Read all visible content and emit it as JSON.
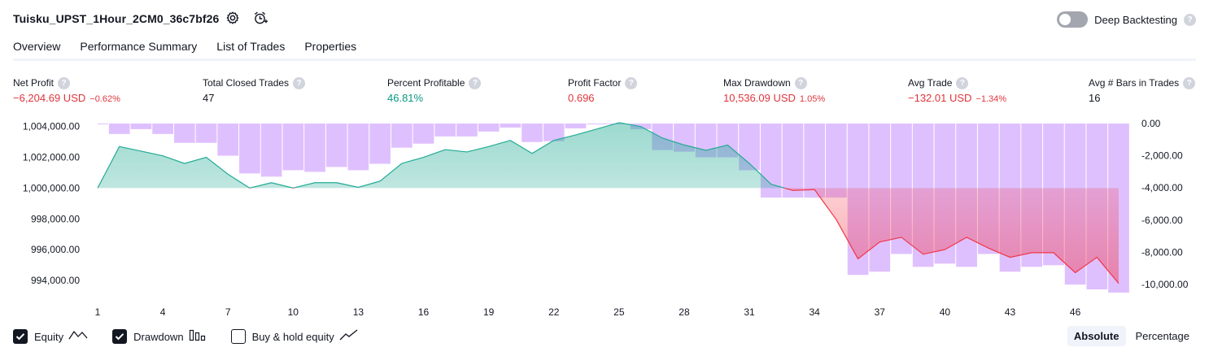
{
  "header": {
    "title": "Tuisku_UPST_1Hour_2CM0_36c7bf26",
    "settings_icon": "gear-icon",
    "alert_icon": "alarm-clock-plus-icon",
    "deep_backtesting_label": "Deep Backtesting",
    "deep_backtesting_enabled": false,
    "help_glyph": "?"
  },
  "tabs": [
    {
      "label": "Overview",
      "active": true
    },
    {
      "label": "Performance Summary",
      "active": false
    },
    {
      "label": "List of Trades",
      "active": false
    },
    {
      "label": "Properties",
      "active": false
    }
  ],
  "metrics": [
    {
      "label": "Net Profit",
      "value": "−6,204.69 USD",
      "pct": "−0.62%",
      "tone": "neg"
    },
    {
      "label": "Total Closed Trades",
      "value": "47",
      "pct": "",
      "tone": "neutral"
    },
    {
      "label": "Percent Profitable",
      "value": "46.81%",
      "pct": "",
      "tone": "pos"
    },
    {
      "label": "Profit Factor",
      "value": "0.696",
      "pct": "",
      "tone": "neg"
    },
    {
      "label": "Max Drawdown",
      "value": "10,536.09 USD",
      "pct": "1.05%",
      "tone": "neg"
    },
    {
      "label": "Avg Trade",
      "value": "−132.01 USD",
      "pct": "−1.34%",
      "tone": "neg"
    },
    {
      "label": "Avg # Bars in Trades",
      "value": "16",
      "pct": "",
      "tone": "neutral"
    }
  ],
  "chart_data": {
    "type": "line",
    "x_ticks": [
      "1",
      "4",
      "7",
      "10",
      "13",
      "16",
      "19",
      "22",
      "25",
      "28",
      "31",
      "34",
      "37",
      "40",
      "43",
      "46"
    ],
    "y_left_ticks": [
      "1,004,000.00",
      "1,002,000.00",
      "1,000,000.00",
      "998,000.00",
      "996,000.00",
      "994,000.00"
    ],
    "y_right_ticks": [
      "0.00",
      "-2,000.00",
      "-4,000.00",
      "-6,000.00",
      "-8,000.00",
      "-10,000.00"
    ],
    "ylim_left": [
      993100,
      1004300
    ],
    "ylim_right": [
      -10600,
      100
    ],
    "xlim": [
      1,
      48
    ],
    "baseline": 1000000,
    "series": [
      {
        "name": "Equity",
        "axis": "left",
        "color": "#22ab94",
        "x": [
          1,
          2,
          3,
          4,
          5,
          6,
          7,
          8,
          9,
          10,
          11,
          12,
          13,
          14,
          15,
          16,
          17,
          18,
          19,
          20,
          21,
          22,
          23,
          24,
          25,
          26,
          27,
          28,
          29,
          30,
          31,
          32,
          33,
          34,
          35,
          36,
          37,
          38,
          39,
          40,
          41,
          42,
          43,
          44,
          45,
          46,
          47,
          48
        ],
        "y": [
          1000000,
          1002700,
          1002400,
          1002100,
          1001600,
          1002000,
          1000900,
          1000000,
          1000350,
          1000000,
          1000350,
          1000350,
          1000050,
          1000450,
          1001600,
          1002000,
          1002500,
          1002350,
          1002700,
          1003100,
          1002250,
          1003100,
          1003450,
          1003850,
          1004250,
          1004000,
          1003250,
          1002800,
          1002450,
          1002800,
          1001600,
          1000250,
          999850,
          999900,
          997950,
          995400,
          996500,
          996800,
          995700,
          996000,
          996800,
          996100,
          995500,
          995800,
          995800,
          994500,
          995500,
          993800
        ]
      },
      {
        "name": "Drawdown",
        "axis": "right",
        "color": "#d9b5ff",
        "x": [
          1,
          2,
          3,
          4,
          5,
          6,
          7,
          8,
          9,
          10,
          11,
          12,
          13,
          14,
          15,
          16,
          17,
          18,
          19,
          20,
          21,
          22,
          23,
          24,
          25,
          26,
          27,
          28,
          29,
          30,
          31,
          32,
          33,
          34,
          35,
          36,
          37,
          38,
          39,
          40,
          41,
          42,
          43,
          44,
          45,
          46,
          47,
          48
        ],
        "y": [
          0,
          -650,
          -350,
          -650,
          -1200,
          -1200,
          -2000,
          -3100,
          -3300,
          -2900,
          -3000,
          -2700,
          -2900,
          -2500,
          -1500,
          -1250,
          -800,
          -800,
          -500,
          -250,
          -1150,
          -1100,
          -300,
          0,
          0,
          -350,
          -1650,
          -1750,
          -2100,
          -2100,
          -2900,
          -4600,
          -4600,
          -4600,
          -4600,
          -9400,
          -9200,
          -8100,
          -8900,
          -8700,
          -8900,
          -8100,
          -9200,
          -8900,
          -8800,
          -10000,
          -10300,
          -10500
        ]
      }
    ],
    "legend": [
      {
        "name": "Equity",
        "checked": true,
        "icon": "equity-line-icon"
      },
      {
        "name": "Drawdown",
        "checked": true,
        "icon": "drawdown-bars-icon"
      },
      {
        "name": "Buy & hold equity",
        "checked": false,
        "icon": "buyhold-line-icon"
      }
    ],
    "grid": false
  },
  "footer": {
    "modes": [
      {
        "label": "Absolute",
        "active": true
      },
      {
        "label": "Percentage",
        "active": false
      }
    ]
  },
  "colors": {
    "text": "#131722",
    "negative": "#e0353d",
    "positive": "#089981",
    "equity_line_up": "#22ab94",
    "equity_line_down": "#f23645",
    "drawdown_bar": "#d9b5ff",
    "tab_rule": "#f0f3fa"
  }
}
